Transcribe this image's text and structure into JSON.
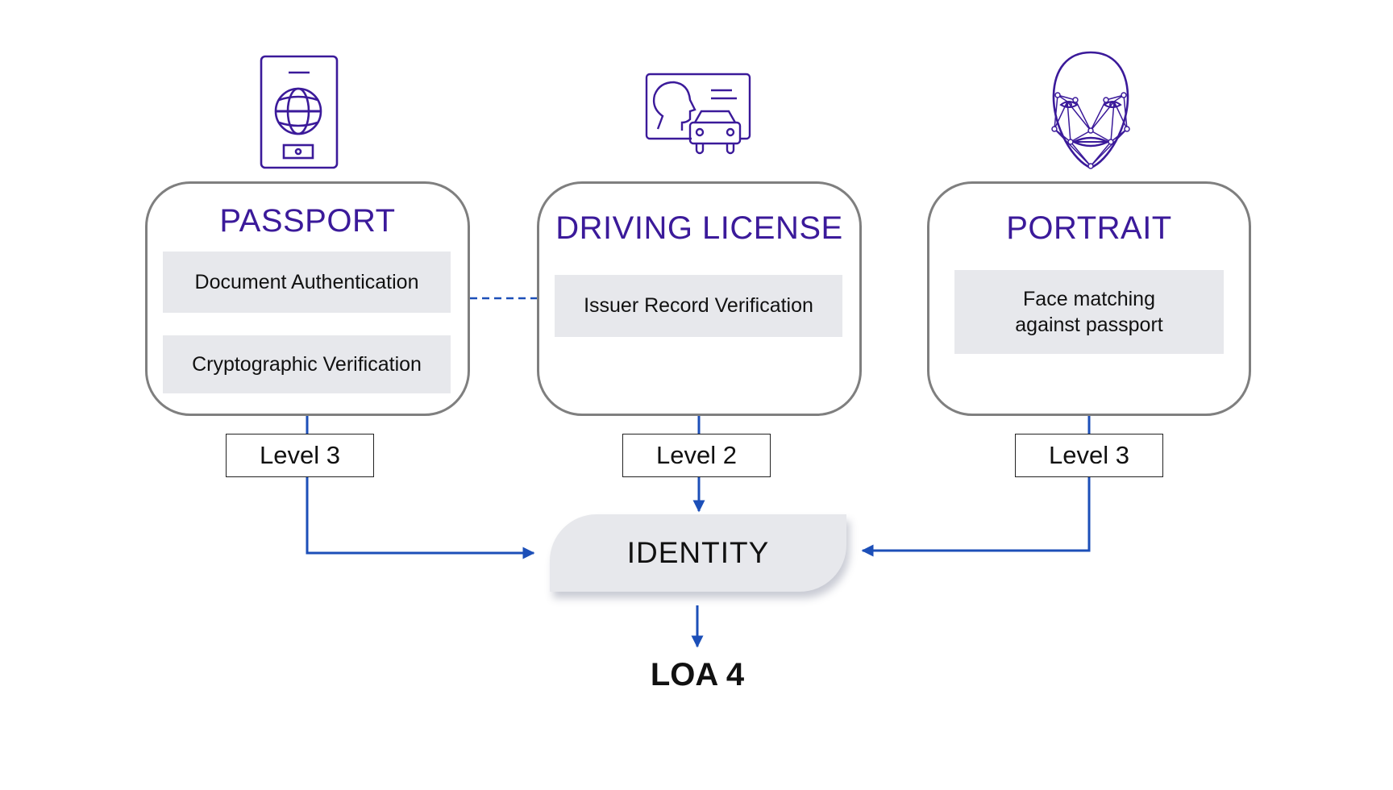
{
  "colors": {
    "accent_purple": "#3b1a9a",
    "connector_blue": "#1c4fb8",
    "card_border": "#7f7f7f",
    "step_fill": "#e7e8ec"
  },
  "sources": [
    {
      "id": "passport",
      "icon": "passport-icon",
      "title": "PASSPORT",
      "steps": [
        "Document Authentication",
        "Cryptographic Verification"
      ],
      "level": "Level 3"
    },
    {
      "id": "driving-license",
      "icon": "driving-license-icon",
      "title": "DRIVING LICENSE",
      "steps": [
        "Issuer Record Verification"
      ],
      "level": "Level 2"
    },
    {
      "id": "portrait",
      "icon": "face-recognition-icon",
      "title": "PORTRAIT",
      "steps": [
        "Face matching against passport"
      ],
      "level": "Level 3"
    }
  ],
  "identity": {
    "label": "IDENTITY"
  },
  "result": {
    "label": "LOA 4"
  }
}
